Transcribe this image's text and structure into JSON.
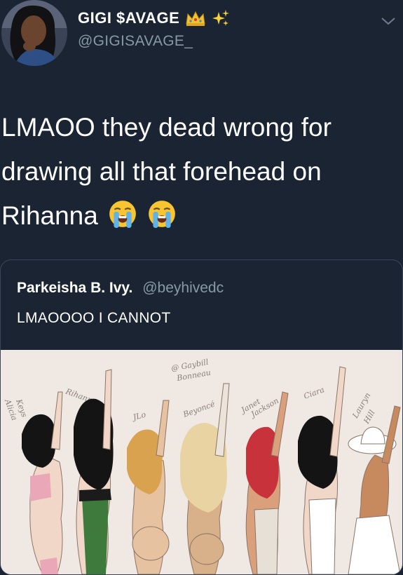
{
  "author": {
    "display_name": "GIGI $AVAGE",
    "name_emojis": [
      "crown-icon",
      "sparkles-icon"
    ],
    "handle": "@GIGISAVAGE_"
  },
  "tweet": {
    "line1": "LMAOO they dead wrong for",
    "line2": "drawing all that forehead on",
    "line3": "Rihanna",
    "emojis": [
      "loudly-crying-face-icon",
      "loudly-crying-face-icon"
    ]
  },
  "quoted_tweet": {
    "name": "Parkeisha B. Ivy.",
    "handle": "@beyhivedc",
    "text": "LMAOOOO I CANNOT",
    "image": {
      "subject": "drawing of seven women with raised hands",
      "labels": [
        "Alicia Keys",
        "Rihanna",
        "JLo",
        "@ Gaybill Bonneau",
        "Beyoncé",
        "Janet Jackson",
        "Ciara",
        "Lauryn Hill"
      ]
    }
  },
  "colors": {
    "background": "#1a2433",
    "secondary_text": "#8899a6",
    "card_border": "#3a4658"
  }
}
